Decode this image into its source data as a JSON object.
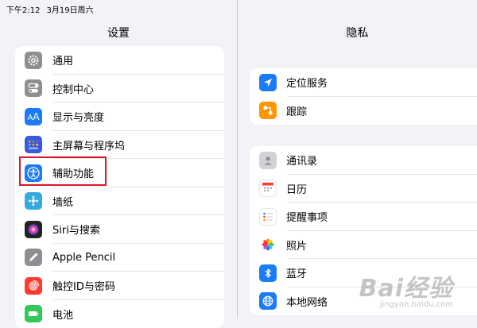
{
  "status_bar": {
    "time": "下午2:12",
    "date": "3月19日周六"
  },
  "left_panel": {
    "title": "设置",
    "items": [
      {
        "label": "通用",
        "icon": "gear-icon",
        "color": "#8e8e93"
      },
      {
        "label": "控制中心",
        "icon": "toggles-icon",
        "color": "#8e8e93"
      },
      {
        "label": "显示与亮度",
        "icon": "text-size-icon",
        "color": "#1c7cf5"
      },
      {
        "label": "主屏幕与程序坞",
        "icon": "home-grid-icon",
        "color": "#3a5bd9"
      },
      {
        "label": "辅助功能",
        "icon": "accessibility-icon",
        "color": "#1c7cf5"
      },
      {
        "label": "墙纸",
        "icon": "wallpaper-icon",
        "color": "#34aadc"
      },
      {
        "label": "Siri与搜索",
        "icon": "siri-icon",
        "color": "#222222"
      },
      {
        "label": "Apple Pencil",
        "icon": "pencil-icon",
        "color": "#8e8e93"
      },
      {
        "label": "触控ID与密码",
        "icon": "fingerprint-icon",
        "color": "#ff3b30"
      },
      {
        "label": "电池",
        "icon": "battery-icon",
        "color": "#34c759"
      }
    ]
  },
  "right_panel": {
    "title": "隐私",
    "group1": [
      {
        "label": "定位服务",
        "icon": "location-arrow-icon",
        "color": "#1c7cf5"
      },
      {
        "label": "跟踪",
        "icon": "tracking-icon",
        "color": "#ff9500"
      }
    ],
    "group2": [
      {
        "label": "通讯录",
        "icon": "contacts-icon",
        "color": "#c7c7cc"
      },
      {
        "label": "日历",
        "icon": "calendar-icon",
        "color": "#ffffff"
      },
      {
        "label": "提醒事项",
        "icon": "reminders-icon",
        "color": "#ffffff"
      },
      {
        "label": "照片",
        "icon": "photos-icon",
        "color": "#ffffff"
      },
      {
        "label": "蓝牙",
        "icon": "bluetooth-icon",
        "color": "#1c7cf5"
      },
      {
        "label": "本地网络",
        "icon": "globe-icon",
        "color": "#1c7cf5"
      }
    ]
  },
  "watermark": {
    "logo": "Bai经验",
    "url": "jingyan.baidu.com"
  }
}
